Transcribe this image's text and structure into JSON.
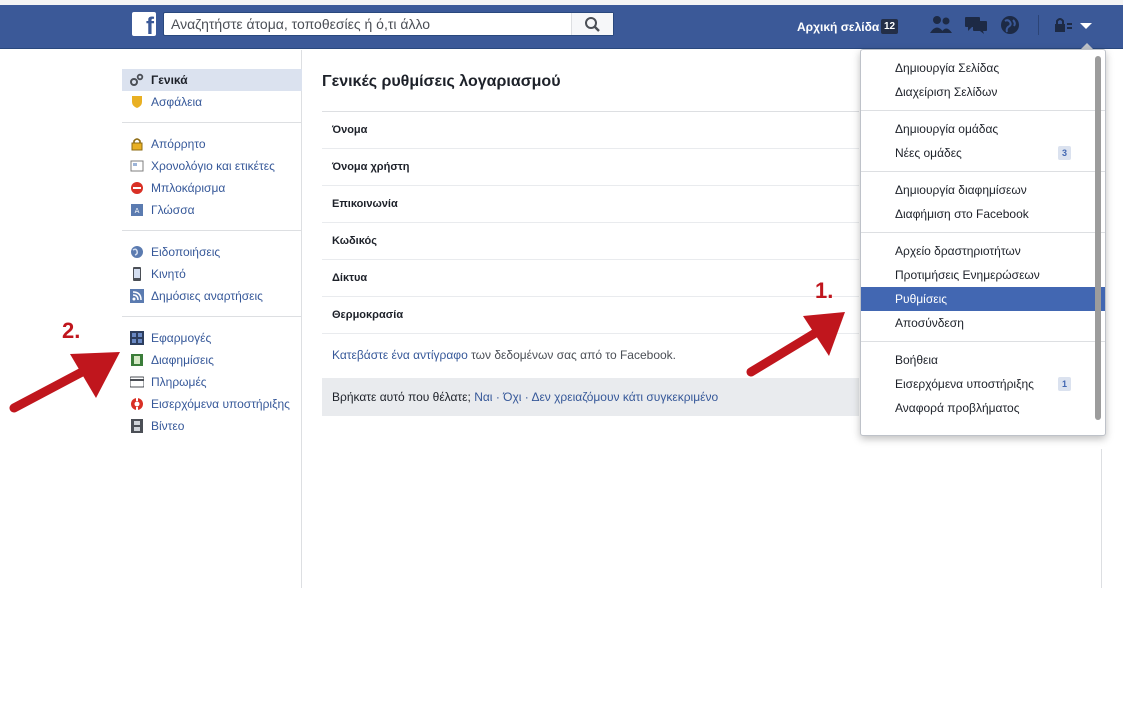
{
  "header": {
    "logo_letter": "f",
    "search_placeholder": "Αναζητήστε άτομα, τοποθεσίες ή ό,τι άλλο",
    "home_label": "Αρχική σελίδα",
    "home_count": "12",
    "brand_color": "#3b5998"
  },
  "sidebar": {
    "groups": [
      {
        "items": [
          {
            "label": "Γενικά",
            "icon": "gears-icon",
            "active": true
          },
          {
            "label": "Ασφάλεια",
            "icon": "shield-icon"
          }
        ]
      },
      {
        "items": [
          {
            "label": "Απόρρητο",
            "icon": "lock-icon"
          },
          {
            "label": "Χρονολόγιο και ετικέτες",
            "icon": "timeline-icon"
          },
          {
            "label": "Μπλοκάρισμα",
            "icon": "block-icon"
          },
          {
            "label": "Γλώσσα",
            "icon": "language-icon"
          }
        ]
      },
      {
        "items": [
          {
            "label": "Ειδοποιήσεις",
            "icon": "globe-icon"
          },
          {
            "label": "Κινητό",
            "icon": "mobile-icon"
          },
          {
            "label": "Δημόσιες αναρτήσεις",
            "icon": "rss-icon"
          }
        ]
      },
      {
        "items": [
          {
            "label": "Εφαρμογές",
            "icon": "apps-icon"
          },
          {
            "label": "Διαφημίσεις",
            "icon": "ads-icon"
          },
          {
            "label": "Πληρωμές",
            "icon": "credit-card-icon"
          },
          {
            "label": "Εισερχόμενα υποστήριξης",
            "icon": "lifebuoy-icon"
          },
          {
            "label": "Βίντεο",
            "icon": "film-icon"
          }
        ]
      }
    ]
  },
  "main": {
    "title": "Γενικές ρυθμίσεις λογαριασμού",
    "rows": [
      "Όνομα",
      "Όνομα χρήστη",
      "Επικοινωνία",
      "Κωδικός",
      "Δίκτυα",
      "Θερμοκρασία"
    ],
    "download_link": "Κατεβάστε ένα αντίγραφο",
    "download_rest": " των δεδομένων σας από το Facebook.",
    "feedback_question": "Βρήκατε αυτό που θέλατε;",
    "feedback_yes": "Ναι",
    "feedback_no": "Όχι",
    "feedback_nothing": "Δεν χρειαζόμουν κάτι συγκεκριμένο",
    "feedback_sep": " · "
  },
  "dropdown": {
    "groups": [
      {
        "items": [
          {
            "label": "Δημιουργία Σελίδας"
          },
          {
            "label": "Διαχείριση Σελίδων"
          }
        ]
      },
      {
        "items": [
          {
            "label": "Δημιουργία ομάδας"
          },
          {
            "label": "Νέες ομάδες",
            "badge": "3"
          }
        ]
      },
      {
        "items": [
          {
            "label": "Δημιουργία διαφημίσεων"
          },
          {
            "label": "Διαφήμιση στο Facebook"
          }
        ]
      },
      {
        "items": [
          {
            "label": "Αρχείο δραστηριοτήτων"
          },
          {
            "label": "Προτιμήσεις Ενημερώσεων"
          },
          {
            "label": "Ρυθμίσεις",
            "active": true
          },
          {
            "label": "Αποσύνδεση"
          }
        ]
      },
      {
        "items": [
          {
            "label": "Βοήθεια"
          },
          {
            "label": "Εισερχόμενα υποστήριξης",
            "badge": "1"
          },
          {
            "label": "Αναφορά προβλήματος"
          }
        ]
      }
    ]
  },
  "annotations": {
    "step1": "1.",
    "step2": "2.",
    "arrow_color": "#c0161d"
  }
}
